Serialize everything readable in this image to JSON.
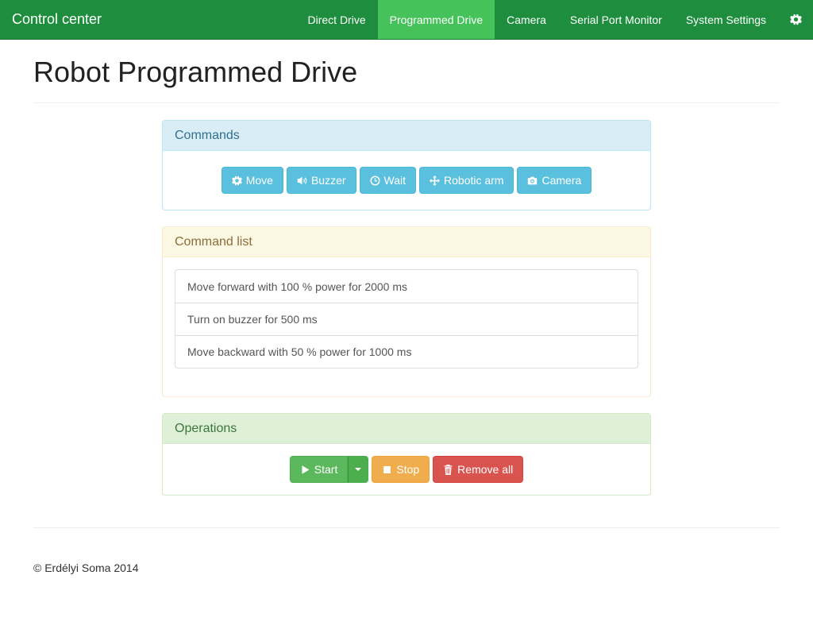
{
  "navbar": {
    "brand": "Control center",
    "items": [
      {
        "label": "Direct Drive",
        "active": false
      },
      {
        "label": "Programmed Drive",
        "active": true
      },
      {
        "label": "Camera",
        "active": false
      },
      {
        "label": "Serial Port Monitor",
        "active": false
      },
      {
        "label": "System Settings",
        "active": false
      }
    ],
    "settings_icon": "gear-icon"
  },
  "page": {
    "title": "Robot Programmed Drive"
  },
  "commands": {
    "heading": "Commands",
    "buttons": [
      {
        "label": "Move",
        "icon": "gear-icon"
      },
      {
        "label": "Buzzer",
        "icon": "volume-icon"
      },
      {
        "label": "Wait",
        "icon": "clock-icon"
      },
      {
        "label": "Robotic arm",
        "icon": "move-arrows-icon"
      },
      {
        "label": "Camera",
        "icon": "camera-icon"
      }
    ]
  },
  "command_list": {
    "heading": "Command list",
    "items": [
      "Move forward with 100 % power for 2000 ms",
      "Turn on buzzer for 500 ms",
      "Move backward with 50 % power for 1000 ms"
    ]
  },
  "operations": {
    "heading": "Operations",
    "start_label": "Start",
    "stop_label": "Stop",
    "remove_all_label": "Remove all"
  },
  "footer": {
    "text": "© Erdélyi Soma 2014"
  },
  "colors": {
    "navbar": "#1e8e3e",
    "nav_active": "#45c35a",
    "info": "#5bc0de",
    "success": "#5cb85c",
    "warning": "#f0ad4e",
    "danger": "#d9534f"
  }
}
